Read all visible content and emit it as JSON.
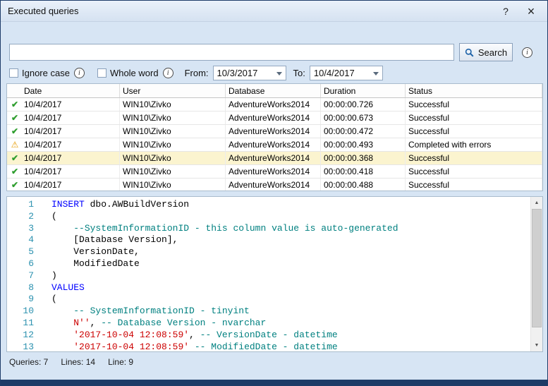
{
  "window": {
    "title": "Executed queries",
    "help_label": "?",
    "close_label": "×"
  },
  "icons": {
    "success": "✔",
    "warning": "⚠",
    "info": "i",
    "scroll_up": "▲",
    "scroll_down": "▼"
  },
  "colors": {
    "keyword": "#0000ff",
    "comment": "#008080",
    "string": "#cc0000",
    "selected_row": "#fbf4cf",
    "success_icon": "#2f9e2f",
    "warning_icon": "#e69b00"
  },
  "search": {
    "value": "",
    "button_label": "Search"
  },
  "filters": {
    "ignore_case_label": "Ignore case",
    "whole_word_label": "Whole word",
    "from_label": "From:",
    "from_value": "10/3/2017",
    "to_label": "To:",
    "to_value": "10/4/2017"
  },
  "table": {
    "columns": [
      "Date",
      "User",
      "Database",
      "Duration",
      "Status"
    ],
    "rows": [
      {
        "icon": "success",
        "date": "10/4/2017",
        "user": "WIN10\\Zivko",
        "database": "AdventureWorks2014",
        "duration": "00:00:00.726",
        "status": "Successful",
        "selected": false
      },
      {
        "icon": "success",
        "date": "10/4/2017",
        "user": "WIN10\\Zivko",
        "database": "AdventureWorks2014",
        "duration": "00:00:00.673",
        "status": "Successful",
        "selected": false
      },
      {
        "icon": "success",
        "date": "10/4/2017",
        "user": "WIN10\\Zivko",
        "database": "AdventureWorks2014",
        "duration": "00:00:00.472",
        "status": "Successful",
        "selected": false
      },
      {
        "icon": "warning",
        "date": "10/4/2017",
        "user": "WIN10\\Zivko",
        "database": "AdventureWorks2014",
        "duration": "00:00:00.493",
        "status": "Completed with errors",
        "selected": false
      },
      {
        "icon": "success",
        "date": "10/4/2017",
        "user": "WIN10\\Zivko",
        "database": "AdventureWorks2014",
        "duration": "00:00:00.368",
        "status": "Successful",
        "selected": true
      },
      {
        "icon": "success",
        "date": "10/4/2017",
        "user": "WIN10\\Zivko",
        "database": "AdventureWorks2014",
        "duration": "00:00:00.418",
        "status": "Successful",
        "selected": false
      },
      {
        "icon": "success",
        "date": "10/4/2017",
        "user": "WIN10\\Zivko",
        "database": "AdventureWorks2014",
        "duration": "00:00:00.488",
        "status": "Successful",
        "selected": false
      }
    ]
  },
  "editor": {
    "lines": [
      {
        "n": "1",
        "segments": [
          {
            "text": "INSERT",
            "type": "keyword"
          },
          {
            "text": " dbo.AWBuildVersion",
            "type": "plain"
          }
        ]
      },
      {
        "n": "2",
        "segments": [
          {
            "text": "(",
            "type": "plain"
          }
        ]
      },
      {
        "n": "3",
        "segments": [
          {
            "text": "    ",
            "type": "plain"
          },
          {
            "text": "--SystemInformationID - this column value is auto-generated",
            "type": "comment"
          }
        ]
      },
      {
        "n": "4",
        "segments": [
          {
            "text": "    [Database Version],",
            "type": "plain"
          }
        ]
      },
      {
        "n": "5",
        "segments": [
          {
            "text": "    VersionDate,",
            "type": "plain"
          }
        ]
      },
      {
        "n": "6",
        "segments": [
          {
            "text": "    ModifiedDate",
            "type": "plain"
          }
        ]
      },
      {
        "n": "7",
        "segments": [
          {
            "text": ")",
            "type": "plain"
          }
        ]
      },
      {
        "n": "8",
        "segments": [
          {
            "text": "VALUES",
            "type": "keyword"
          }
        ]
      },
      {
        "n": "9",
        "segments": [
          {
            "text": "(",
            "type": "plain"
          }
        ]
      },
      {
        "n": "10",
        "segments": [
          {
            "text": "    ",
            "type": "plain"
          },
          {
            "text": "-- SystemInformationID - tinyint",
            "type": "comment"
          }
        ]
      },
      {
        "n": "11",
        "segments": [
          {
            "text": "    ",
            "type": "plain"
          },
          {
            "text": "N''",
            "type": "string"
          },
          {
            "text": ", ",
            "type": "plain"
          },
          {
            "text": "-- Database Version - nvarchar",
            "type": "comment"
          }
        ]
      },
      {
        "n": "12",
        "segments": [
          {
            "text": "    ",
            "type": "plain"
          },
          {
            "text": "'2017-10-04 12:08:59'",
            "type": "string"
          },
          {
            "text": ", ",
            "type": "plain"
          },
          {
            "text": "-- VersionDate - datetime",
            "type": "comment"
          }
        ]
      },
      {
        "n": "13",
        "segments": [
          {
            "text": "    ",
            "type": "plain"
          },
          {
            "text": "'2017-10-04 12:08:59'",
            "type": "string"
          },
          {
            "text": " ",
            "type": "plain"
          },
          {
            "text": "-- ModifiedDate - datetime",
            "type": "comment"
          }
        ]
      }
    ]
  },
  "status_bar": {
    "queries": "Queries: 7",
    "lines": "Lines: 14",
    "line": "Line: 9"
  }
}
